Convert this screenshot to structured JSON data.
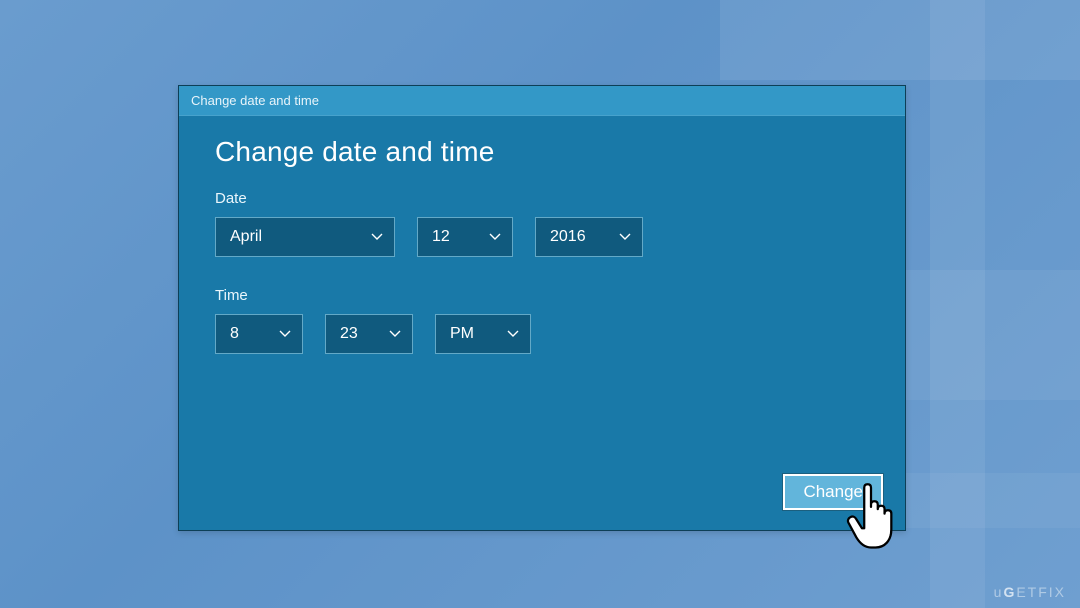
{
  "dialog": {
    "titlebar": "Change date and time",
    "heading": "Change date and time",
    "date_label": "Date",
    "time_label": "Time",
    "date": {
      "month": "April",
      "day": "12",
      "year": "2016"
    },
    "time": {
      "hour": "8",
      "minute": "23",
      "ampm": "PM"
    },
    "button_label": "Change"
  },
  "watermark": "uGETFIX"
}
